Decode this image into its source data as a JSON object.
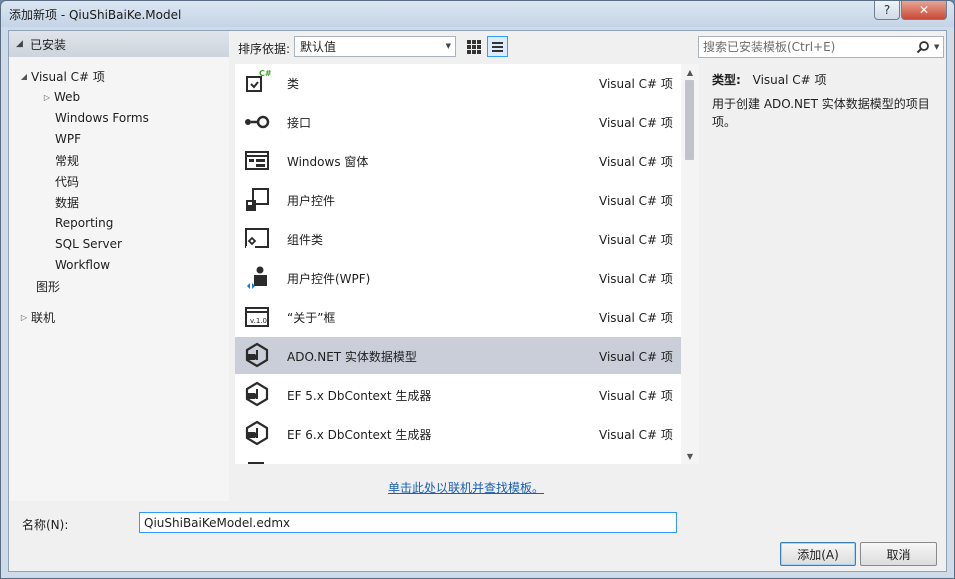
{
  "window": {
    "title": "添加新项 - QiuShiBaiKe.Model",
    "help_label": "?",
    "close_label": "✕"
  },
  "tree": {
    "header": "已安装",
    "items": [
      {
        "label": "Visual C# 项",
        "expander": "◢"
      },
      {
        "label": "Web",
        "expander": "▷"
      },
      {
        "label": "Windows Forms",
        "expander": ""
      },
      {
        "label": "WPF",
        "expander": ""
      },
      {
        "label": "常规",
        "expander": ""
      },
      {
        "label": "代码",
        "expander": ""
      },
      {
        "label": "数据",
        "expander": ""
      },
      {
        "label": "Reporting",
        "expander": ""
      },
      {
        "label": "SQL Server",
        "expander": ""
      },
      {
        "label": "Workflow",
        "expander": ""
      },
      {
        "label": "图形",
        "expander": ""
      },
      {
        "label": "联机",
        "expander": "▷"
      }
    ]
  },
  "toolbar": {
    "sort_label": "排序依据:",
    "sort_value": "默认值"
  },
  "templates": [
    {
      "name": "类",
      "lang": "Visual C# 项",
      "icon": "class-icon"
    },
    {
      "name": "接口",
      "lang": "Visual C# 项",
      "icon": "interface-icon"
    },
    {
      "name": "Windows 窗体",
      "lang": "Visual C# 项",
      "icon": "windows-form-icon"
    },
    {
      "name": "用户控件",
      "lang": "Visual C# 项",
      "icon": "user-control-icon"
    },
    {
      "name": "组件类",
      "lang": "Visual C# 项",
      "icon": "component-class-icon"
    },
    {
      "name": "用户控件(WPF)",
      "lang": "Visual C# 项",
      "icon": "wpf-user-control-icon"
    },
    {
      "name": "“关于”框",
      "lang": "Visual C# 项",
      "icon": "about-box-icon"
    },
    {
      "name": "ADO.NET 实体数据模型",
      "lang": "Visual C# 项",
      "icon": "entity-model-icon"
    },
    {
      "name": "EF 5.x DbContext 生成器",
      "lang": "Visual C# 项",
      "icon": "ef-generator-icon"
    },
    {
      "name": "EF 6.x DbContext 生成器",
      "lang": "Visual C# 项",
      "icon": "ef-generator-icon"
    }
  ],
  "online_link": "单击此处以联机并查找模板。",
  "search": {
    "placeholder": "搜索已安装模板(Ctrl+E)"
  },
  "details": {
    "type_key": "类型:",
    "type_value": "Visual C# 项",
    "description": "用于创建 ADO.NET 实体数据模型的项目项。"
  },
  "name_field": {
    "label": "名称(N):",
    "value": "QiuShiBaiKeModel.edmx"
  },
  "buttons": {
    "add": "添加(A)",
    "cancel": "取消"
  }
}
